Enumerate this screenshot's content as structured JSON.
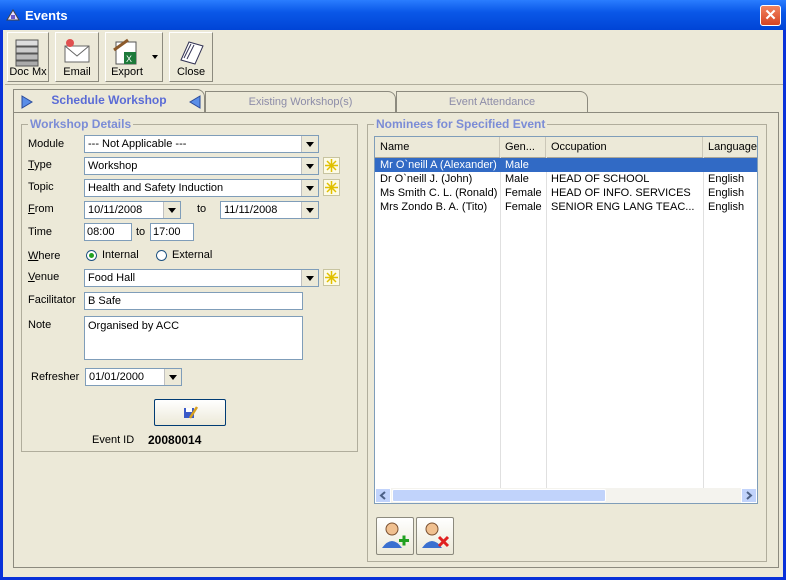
{
  "window": {
    "title": "Events"
  },
  "toolbar": {
    "docmx_label": "Doc Mx",
    "email_label": "Email",
    "export_label": "Export",
    "close_label": "Close"
  },
  "tabs": [
    "Schedule Workshop",
    "Existing Workshop(s)",
    "Event Attendance"
  ],
  "details": {
    "title": "Workshop Details",
    "module_label": "Module",
    "module_value": "--- Not Applicable ---",
    "type_label": "Type",
    "type_value": "Workshop",
    "topic_label": "Topic",
    "topic_value": "Health and Safety Induction",
    "from_label": "From",
    "from_value": "10/11/2008",
    "to_label": "to",
    "to_value": "11/11/2008",
    "time_label": "Time",
    "time_from_h": "08",
    "time_from_m": "00",
    "time_to_label": "to",
    "time_to_h": "17",
    "time_to_m": "00",
    "where_label": "Where",
    "where_internal": "Internal",
    "where_external": "External",
    "where_selected": "Internal",
    "venue_label": "Venue",
    "venue_value": "Food Hall",
    "facilitator_label": "Facilitator",
    "facilitator_value": "B Safe",
    "note_label": "Note",
    "note_value": "Organised by ACC",
    "refresher_label": "Refresher",
    "refresher_value": "01/01/2000",
    "event_id_label": "Event ID",
    "event_id_value": "20080014"
  },
  "nominees": {
    "title": "Nominees for Specified Event",
    "columns": [
      "Name",
      "Gen...",
      "Occupation",
      "Language"
    ],
    "rows": [
      [
        "Mr O`neill A (Alexander)",
        "Male",
        "",
        ""
      ],
      [
        "Dr O`neill J. (John)",
        "Male",
        "HEAD OF SCHOOL",
        "English"
      ],
      [
        "Ms Smith C. L. (Ronald)",
        "Female",
        "HEAD OF INFO. SERVICES",
        "English"
      ],
      [
        "Mrs Zondo B. A. (Tito)",
        "Female",
        "SENIOR ENG LANG TEAC...",
        "English"
      ]
    ],
    "selected_row": 0
  }
}
